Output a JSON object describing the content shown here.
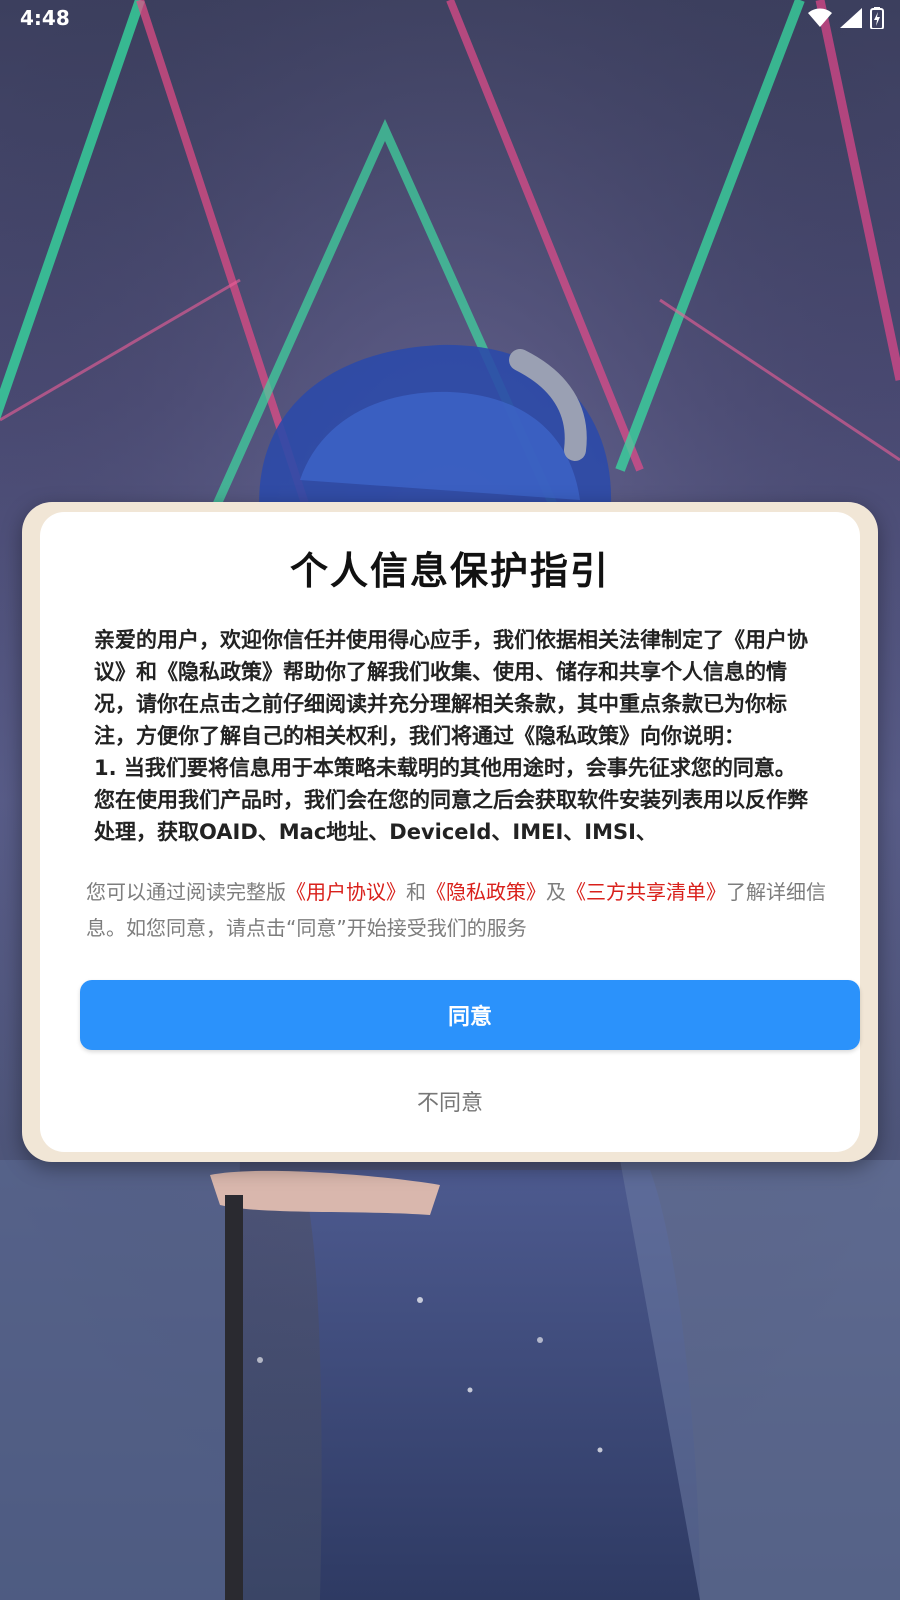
{
  "status_bar": {
    "time": "4:48",
    "icons": [
      "wifi-icon",
      "cellular-signal-icon",
      "battery-charging-icon"
    ]
  },
  "background": {
    "description_icon": "illustration",
    "colors": [
      "#3c3f5e",
      "#e0457c",
      "#34d29b",
      "#2d4fb0"
    ]
  },
  "dialog": {
    "title": "个人信息保护指引",
    "body_paragraphs": [
      "亲爱的用户，欢迎你信任并使用得心应手，我们依据相关法律制定了《用户协议》和《隐私政策》帮助你了解我们收集、使用、储存和共享个人信息的情况，请你在点击之前仔细阅读并充分理解相关条款，其中重点条款已为你标注，方便你了解自己的相关权利，我们将通过《隐私政策》向你说明：",
      "1. 当我们要将信息用于本策略未载明的其他用途时，会事先征求您的同意。 您在使用我们产品时，我们会在您的同意之后会获取软件安装列表用以反作弊处理，获取OAID、Mac地址、DeviceId、IMEI、IMSI、"
    ],
    "summary": {
      "prefix": "您可以通过阅读完整版",
      "link_user_agreement": "《用户协议》",
      "and": "和",
      "link_privacy_policy": "《隐私政策》",
      "and2": "及",
      "link_third_party_list": "《三方共享清单》",
      "suffix": "了解详细信息。如您同意，请点击“同意”开始接受我们的服务"
    },
    "agree_label": "同意",
    "disagree_label": "不同意",
    "colors": {
      "accent": "#2b92fb",
      "link": "#d9201b",
      "frame": "#f1e6d6"
    }
  }
}
